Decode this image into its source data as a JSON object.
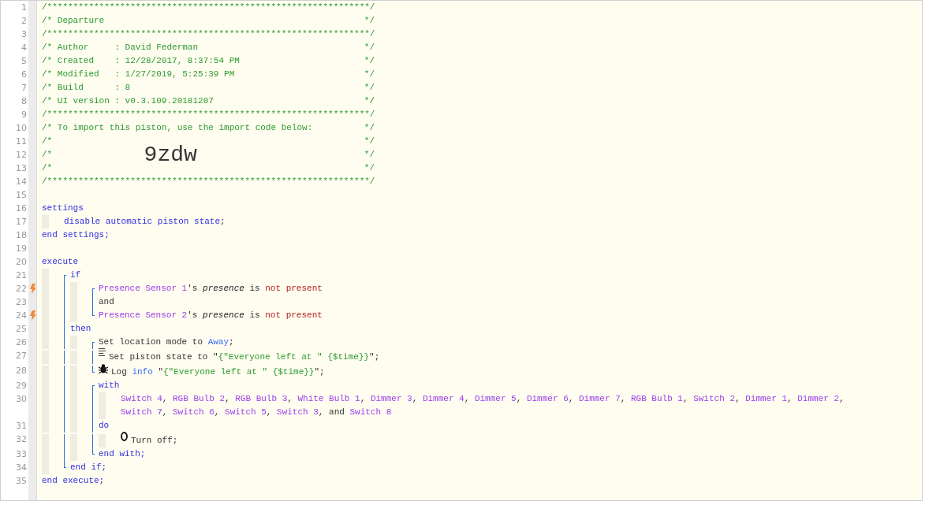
{
  "editor": {
    "lines": [
      {
        "kind": "line",
        "number": "1",
        "trigger": false,
        "tokens": [
          {
            "text": "/**************************************************************/",
            "kind": "comment"
          }
        ]
      },
      {
        "kind": "line",
        "number": "2",
        "trigger": false,
        "tokens": [
          {
            "text": "/* Departure",
            "kind": "comment"
          },
          {
            "text": "*/",
            "kind": "comment-end"
          }
        ]
      },
      {
        "kind": "line",
        "number": "3",
        "trigger": false,
        "tokens": [
          {
            "text": "/**************************************************************/",
            "kind": "comment"
          }
        ]
      },
      {
        "kind": "line",
        "number": "4",
        "trigger": false,
        "tokens": [
          {
            "text": "/* Author     : David Federman",
            "kind": "comment"
          },
          {
            "text": "*/",
            "kind": "comment-end"
          }
        ]
      },
      {
        "kind": "line",
        "number": "5",
        "trigger": false,
        "tokens": [
          {
            "text": "/* Created    : 12/28/2017, 8:37:54 PM",
            "kind": "comment"
          },
          {
            "text": "*/",
            "kind": "comment-end"
          }
        ]
      },
      {
        "kind": "line",
        "number": "6",
        "trigger": false,
        "tokens": [
          {
            "text": "/* Modified   : 1/27/2019, 5:25:39 PM",
            "kind": "comment"
          },
          {
            "text": "*/",
            "kind": "comment-end"
          }
        ]
      },
      {
        "kind": "line",
        "number": "7",
        "trigger": false,
        "tokens": [
          {
            "text": "/* Build      : 8",
            "kind": "comment"
          },
          {
            "text": "*/",
            "kind": "comment-end"
          }
        ]
      },
      {
        "kind": "line",
        "number": "8",
        "trigger": false,
        "tokens": [
          {
            "text": "/* UI version : v0.3.109.20181207",
            "kind": "comment"
          },
          {
            "text": "*/",
            "kind": "comment-end"
          }
        ]
      },
      {
        "kind": "line",
        "number": "9",
        "trigger": false,
        "tokens": [
          {
            "text": "/**************************************************************/",
            "kind": "comment"
          }
        ]
      },
      {
        "kind": "line",
        "number": "10",
        "trigger": false,
        "tokens": [
          {
            "text": "/* To import this piston, use the import code below:",
            "kind": "comment"
          },
          {
            "text": "*/",
            "kind": "comment-end"
          }
        ]
      },
      {
        "kind": "line",
        "number": "11",
        "trigger": false,
        "tokens": [
          {
            "text": "/*",
            "kind": "comment"
          },
          {
            "text": "*/",
            "kind": "comment-end"
          }
        ]
      },
      {
        "kind": "line",
        "number": "12",
        "trigger": false,
        "tokens": [
          {
            "text": "/*",
            "kind": "comment"
          },
          {
            "text": "9zdw",
            "kind": "import-code"
          },
          {
            "text": "*/",
            "kind": "comment-end"
          }
        ]
      },
      {
        "kind": "line",
        "number": "13",
        "trigger": false,
        "tokens": [
          {
            "text": "/*",
            "kind": "comment"
          },
          {
            "text": "*/",
            "kind": "comment-end"
          }
        ]
      },
      {
        "kind": "line",
        "number": "14",
        "trigger": false,
        "tokens": [
          {
            "text": "/**************************************************************/",
            "kind": "comment"
          }
        ]
      },
      {
        "kind": "line",
        "number": "15",
        "trigger": false
      },
      {
        "kind": "line",
        "number": "16",
        "trigger": false,
        "tokens": [
          {
            "text": "settings",
            "kind": "keyword"
          }
        ]
      },
      {
        "kind": "body",
        "items": [
          {
            "kind": "line",
            "number": "17",
            "trigger": false,
            "tokens": [
              {
                "text": "disable automatic piston state",
                "kind": "keyword"
              },
              {
                "text": ";",
                "kind": "text"
              }
            ]
          }
        ]
      },
      {
        "kind": "line",
        "number": "18",
        "trigger": false,
        "tokens": [
          {
            "text": "end settings;",
            "kind": "keyword"
          }
        ]
      },
      {
        "kind": "line",
        "number": "19",
        "trigger": false
      },
      {
        "kind": "line",
        "number": "20",
        "trigger": false,
        "tokens": [
          {
            "text": "execute",
            "kind": "keyword"
          }
        ]
      },
      {
        "kind": "body",
        "items": [
          {
            "kind": "group",
            "items": [
              {
                "kind": "line",
                "number": "21",
                "trigger": false,
                "tokens": [
                  {
                    "text": "if",
                    "kind": "keyword"
                  }
                ]
              },
              {
                "kind": "body",
                "items": [
                  {
                    "kind": "group",
                    "items": [
                      {
                        "kind": "line",
                        "number": "22",
                        "trigger": true,
                        "tokens": [
                          {
                            "text": "Presence Sensor 1",
                            "kind": "device"
                          },
                          {
                            "text": "'s ",
                            "kind": "text"
                          },
                          {
                            "text": "presence",
                            "kind": "attribute"
                          },
                          {
                            "text": " is ",
                            "kind": "text"
                          },
                          {
                            "text": "not present",
                            "kind": "operator"
                          }
                        ]
                      },
                      {
                        "kind": "line",
                        "number": "23",
                        "trigger": false,
                        "tokens": [
                          {
                            "text": "and",
                            "kind": "text"
                          }
                        ]
                      },
                      {
                        "kind": "line",
                        "number": "24",
                        "trigger": true,
                        "tokens": [
                          {
                            "text": "Presence Sensor 2",
                            "kind": "device"
                          },
                          {
                            "text": "'s ",
                            "kind": "text"
                          },
                          {
                            "text": "presence",
                            "kind": "attribute"
                          },
                          {
                            "text": " is ",
                            "kind": "text"
                          },
                          {
                            "text": "not present",
                            "kind": "operator"
                          }
                        ]
                      }
                    ]
                  }
                ]
              },
              {
                "kind": "line",
                "number": "25",
                "trigger": false,
                "tokens": [
                  {
                    "text": "then",
                    "kind": "keyword"
                  }
                ]
              },
              {
                "kind": "body",
                "items": [
                  {
                    "kind": "group",
                    "items": [
                      {
                        "kind": "line",
                        "number": "26",
                        "trigger": false,
                        "tokens": [
                          {
                            "text": "Set location mode to ",
                            "kind": "text"
                          },
                          {
                            "text": "Away",
                            "kind": "value"
                          },
                          {
                            "text": ";",
                            "kind": "text"
                          }
                        ]
                      },
                      {
                        "kind": "state",
                        "number": "27",
                        "trigger": false,
                        "tokens": [
                          {
                            "text": "Set piston state to \"",
                            "kind": "text"
                          },
                          {
                            "text": "{\"Everyone left at \" {$time}}",
                            "kind": "string"
                          },
                          {
                            "text": "\";",
                            "kind": "text"
                          }
                        ]
                      },
                      {
                        "kind": "log",
                        "number": "28",
                        "trigger": false,
                        "tokens": [
                          {
                            "text": "Log ",
                            "kind": "text"
                          },
                          {
                            "text": "info",
                            "kind": "value"
                          },
                          {
                            "text": " \"",
                            "kind": "text"
                          },
                          {
                            "text": "{\"Everyone left at \" {$time}}",
                            "kind": "string"
                          },
                          {
                            "text": "\";",
                            "kind": "text"
                          }
                        ]
                      }
                    ]
                  },
                  {
                    "kind": "group",
                    "items": [
                      {
                        "kind": "line",
                        "number": "29",
                        "trigger": false,
                        "tokens": [
                          {
                            "text": "with",
                            "kind": "keyword"
                          }
                        ]
                      },
                      {
                        "kind": "body",
                        "items": [
                          {
                            "kind": "line",
                            "number": "30",
                            "trigger": false,
                            "tokens": [
                              {
                                "text": "Switch 4",
                                "kind": "device"
                              },
                              {
                                "text": ", ",
                                "kind": "text"
                              },
                              {
                                "text": "RGB Bulb 2",
                                "kind": "device"
                              },
                              {
                                "text": ", ",
                                "kind": "text"
                              },
                              {
                                "text": "RGB Bulb 3",
                                "kind": "device"
                              },
                              {
                                "text": ", ",
                                "kind": "text"
                              },
                              {
                                "text": "White Bulb 1",
                                "kind": "device"
                              },
                              {
                                "text": ", ",
                                "kind": "text"
                              },
                              {
                                "text": "Dimmer 3",
                                "kind": "device"
                              },
                              {
                                "text": ", ",
                                "kind": "text"
                              },
                              {
                                "text": "Dimmer 4",
                                "kind": "device"
                              },
                              {
                                "text": ", ",
                                "kind": "text"
                              },
                              {
                                "text": "Dimmer 5",
                                "kind": "device"
                              },
                              {
                                "text": ", ",
                                "kind": "text"
                              },
                              {
                                "text": "Dimmer 6",
                                "kind": "device"
                              },
                              {
                                "text": ", ",
                                "kind": "text"
                              },
                              {
                                "text": "Dimmer 7",
                                "kind": "device"
                              },
                              {
                                "text": ", ",
                                "kind": "text"
                              },
                              {
                                "text": "RGB Bulb 1",
                                "kind": "device"
                              },
                              {
                                "text": ", ",
                                "kind": "text"
                              },
                              {
                                "text": "Switch 2",
                                "kind": "device"
                              },
                              {
                                "text": ", ",
                                "kind": "text"
                              },
                              {
                                "text": "Dimmer 1",
                                "kind": "device"
                              },
                              {
                                "text": ", ",
                                "kind": "text"
                              },
                              {
                                "text": "Dimmer 2",
                                "kind": "device"
                              },
                              {
                                "text": ", ",
                                "kind": "text"
                              },
                              {
                                "text": "Switch 7",
                                "kind": "device"
                              },
                              {
                                "text": ", ",
                                "kind": "text"
                              },
                              {
                                "text": "Switch 6",
                                "kind": "device"
                              },
                              {
                                "text": ", ",
                                "kind": "text"
                              },
                              {
                                "text": "Switch 5",
                                "kind": "device"
                              },
                              {
                                "text": ", ",
                                "kind": "text"
                              },
                              {
                                "text": "Switch 3",
                                "kind": "device"
                              },
                              {
                                "text": ", and ",
                                "kind": "text"
                              },
                              {
                                "text": "Switch 8",
                                "kind": "device"
                              }
                            ]
                          }
                        ]
                      },
                      {
                        "kind": "line",
                        "number": "31",
                        "trigger": false,
                        "tokens": [
                          {
                            "text": "do",
                            "kind": "keyword"
                          }
                        ]
                      },
                      {
                        "kind": "body",
                        "items": [
                          {
                            "kind": "command",
                            "number": "32",
                            "trigger": false,
                            "tokens": [
                              {
                                "text": "Turn off;",
                                "kind": "text"
                              }
                            ]
                          }
                        ]
                      },
                      {
                        "kind": "line",
                        "number": "33",
                        "trigger": false,
                        "tokens": [
                          {
                            "text": "end with;",
                            "kind": "keyword"
                          }
                        ]
                      }
                    ]
                  }
                ]
              },
              {
                "kind": "line",
                "number": "34",
                "trigger": false,
                "tokens": [
                  {
                    "text": "end if;",
                    "kind": "keyword"
                  }
                ]
              }
            ]
          }
        ]
      },
      {
        "kind": "line",
        "number": "35",
        "trigger": false,
        "tokens": [
          {
            "text": "end execute;",
            "kind": "keyword"
          }
        ]
      }
    ]
  }
}
